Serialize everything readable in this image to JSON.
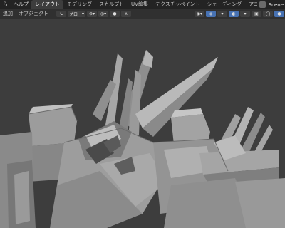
{
  "topbar": {
    "logo_prefix": "ら",
    "help_menu": "ヘルプ",
    "workspace_tabs": [
      {
        "label": "レイアウト",
        "active": true
      },
      {
        "label": "モデリング",
        "active": false
      },
      {
        "label": "スカルプト",
        "active": false
      },
      {
        "label": "UV編集",
        "active": false
      },
      {
        "label": "テクスチャペイント",
        "active": false
      },
      {
        "label": "シェーディング",
        "active": false
      },
      {
        "label": "アニメー",
        "active": false
      }
    ],
    "scene_name": "Scene"
  },
  "header": {
    "add_menu": "追加",
    "object_menu": "オブジェクト",
    "transform_orientation": "グロー",
    "snap_label": "⊘",
    "proportional_label": "∧"
  },
  "colors": {
    "accent": "#4772b3",
    "model_fill": "#9e9e9e",
    "viewport_bg": "#3d3d3d"
  }
}
